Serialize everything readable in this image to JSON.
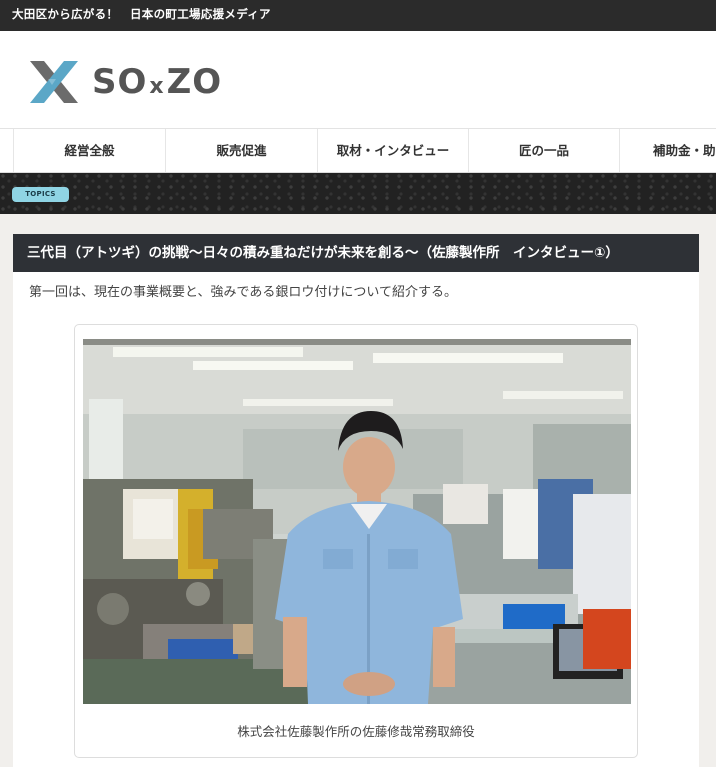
{
  "topbar": {
    "text": "大田区から広がる！　日本の町工場応援メディア"
  },
  "header": {
    "logo": {
      "mark": "X",
      "text_left": "SO",
      "text_x": "x",
      "text_right": "ZO",
      "mark_color": "#5ba7c7",
      "text_color": "#555555"
    }
  },
  "nav": {
    "items": [
      {
        "label": "経営全般"
      },
      {
        "label": "販売促進"
      },
      {
        "label": "取材・インタビュー"
      },
      {
        "label": "匠の一品"
      },
      {
        "label": "補助金・助"
      }
    ]
  },
  "topics": {
    "badge": "TOPICS"
  },
  "article": {
    "title": "三代目（アトツギ）の挑戦〜日々の積み重ねだけが未来を創る〜（佐藤製作所　インタビュー①）",
    "lead": "第一回は、現在の事業概要と、強みである銀ロウ付けについて紹介する。",
    "figure": {
      "caption": "株式会社佐藤製作所の佐藤修哉常務取締役"
    }
  },
  "colors": {
    "topbar_bg": "#2b2b2b",
    "title_bg": "#2e3136",
    "badge_bg": "#8fd4e4",
    "shirt": "#8fb6dc"
  }
}
